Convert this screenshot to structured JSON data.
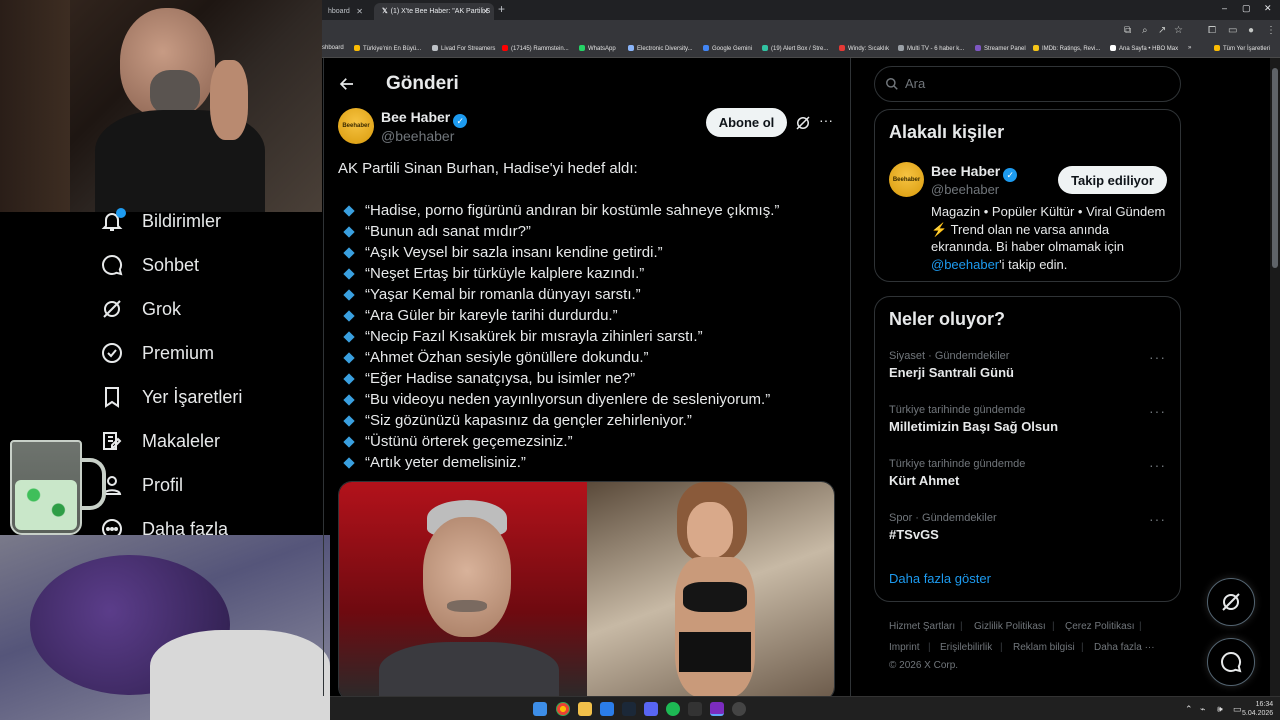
{
  "browser": {
    "tabs": [
      {
        "label": "hboard",
        "active": false
      },
      {
        "label": "(1) X'te Bee Haber: \"AK Partili S",
        "active": true
      }
    ],
    "bookmarks": [
      {
        "label": "shboard",
        "color": "#8ab4f8"
      },
      {
        "label": "Türkiye'nin En Büyü...",
        "color": "#fbbc04"
      },
      {
        "label": "Livad For Streamers",
        "color": "#bdc1c6"
      },
      {
        "label": "(17145) Rammstein...",
        "color": "#ff0000"
      },
      {
        "label": "WhatsApp",
        "color": "#25d366"
      },
      {
        "label": "Electronic Diversity...",
        "color": "#8ab4f8"
      },
      {
        "label": "Google Gemini",
        "color": "#4285f4"
      },
      {
        "label": "(19) Alert Box / Stre...",
        "color": "#31c3a2"
      },
      {
        "label": "Windy: Sıcaklık",
        "color": "#e53935"
      },
      {
        "label": "Multi TV - 6 haber k...",
        "color": "#9aa0a6"
      },
      {
        "label": "Streamer Panel",
        "color": "#7e57c2"
      },
      {
        "label": "IMDb: Ratings, Revi...",
        "color": "#f5c518"
      },
      {
        "label": "Ana Sayfa • HBO Max",
        "color": "#ffffff"
      },
      {
        "label": "Tüm Yer İşaretleri",
        "color": "#fbbc04"
      }
    ]
  },
  "nav": {
    "items": [
      {
        "label": "Bildirimler",
        "icon": "bell-icon"
      },
      {
        "label": "Sohbet",
        "icon": "chat-icon"
      },
      {
        "label": "Grok",
        "icon": "grok-icon"
      },
      {
        "label": "Premium",
        "icon": "premium-icon"
      },
      {
        "label": "Yer İşaretleri",
        "icon": "bookmark-icon"
      },
      {
        "label": "Makaleler",
        "icon": "articles-icon"
      },
      {
        "label": "Profil",
        "icon": "profile-icon"
      },
      {
        "label": "Daha fazla",
        "icon": "more-icon"
      }
    ]
  },
  "post": {
    "header_title": "Gönderi",
    "author_name": "Bee Haber",
    "author_handle": "@beehaber",
    "avatar_text": "Beehaber",
    "subscribe_label": "Abone ol",
    "intro": "AK Partili Sinan Burhan, Hadise'yi hedef aldı:",
    "quotes": [
      "“Hadise, porno figürünü andıran bir kostümle sahneye çıkmış.”",
      "“Bunun adı sanat mıdır?”",
      "“Aşık Veysel bir sazla insanı kendine getirdi.”",
      "“Neşet Ertaş bir türküyle kalplere kazındı.”",
      "“Yaşar Kemal bir romanla dünyayı sarstı.”",
      "“Ara Güler bir kareyle tarihi durdurdu.”",
      "“Necip Fazıl Kısakürek bir mısrayla zihinleri sarstı.”",
      "“Ahmet Özhan sesiyle gönüllere dokundu.”",
      "“Eğer Hadise sanatçıysa, bu isimler ne?”",
      "“Bu videoyu neden yayınlıyorsun diyenlere de sesleniyorum.”",
      "“Siz gözünüzü kapasınız da gençler zehirleniyor.”",
      "“Üstünü örterek geçemezsiniz.”",
      "“Artık yeter demelisiniz.”"
    ]
  },
  "sidebar": {
    "search_placeholder": "Ara",
    "related_title": "Alakalı kişiler",
    "related": {
      "name": "Bee Haber",
      "handle": "@beehaber",
      "follow_label": "Takip ediliyor",
      "bio_prefix": "Magazin • Popüler Kültür • Viral Gündem ⚡ Trend olan ne varsa anında ekranında. Bi haber olmamak için ",
      "bio_link": "@beehaber",
      "bio_suffix": "'i takip edin."
    },
    "trends_title": "Neler oluyor?",
    "trends": [
      {
        "category": "Siyaset · Gündemdekiler",
        "name": "Enerji Santrali Günü"
      },
      {
        "category": "Türkiye tarihinde gündemde",
        "name": "Milletimizin Başı Sağ Olsun"
      },
      {
        "category": "Türkiye tarihinde gündemde",
        "name": "Kürt Ahmet"
      },
      {
        "category": "Spor · Gündemdekiler",
        "name": "#TSvGS"
      }
    ],
    "show_more": "Daha fazla göster",
    "footer": [
      "Hizmet Şartları",
      "Gizlilik Politikası",
      "Çerez Politikası",
      "Imprint",
      "Erişilebilirlik",
      "Reklam bilgisi",
      "Daha fazla ···"
    ],
    "copyright": "© 2026 X Corp."
  },
  "taskbar": {
    "time": "16:34",
    "date": "5.04.2026"
  },
  "colors": {
    "accent": "#1d9bf0",
    "background": "#000000",
    "border": "#2f3336",
    "muted": "#71767b"
  }
}
